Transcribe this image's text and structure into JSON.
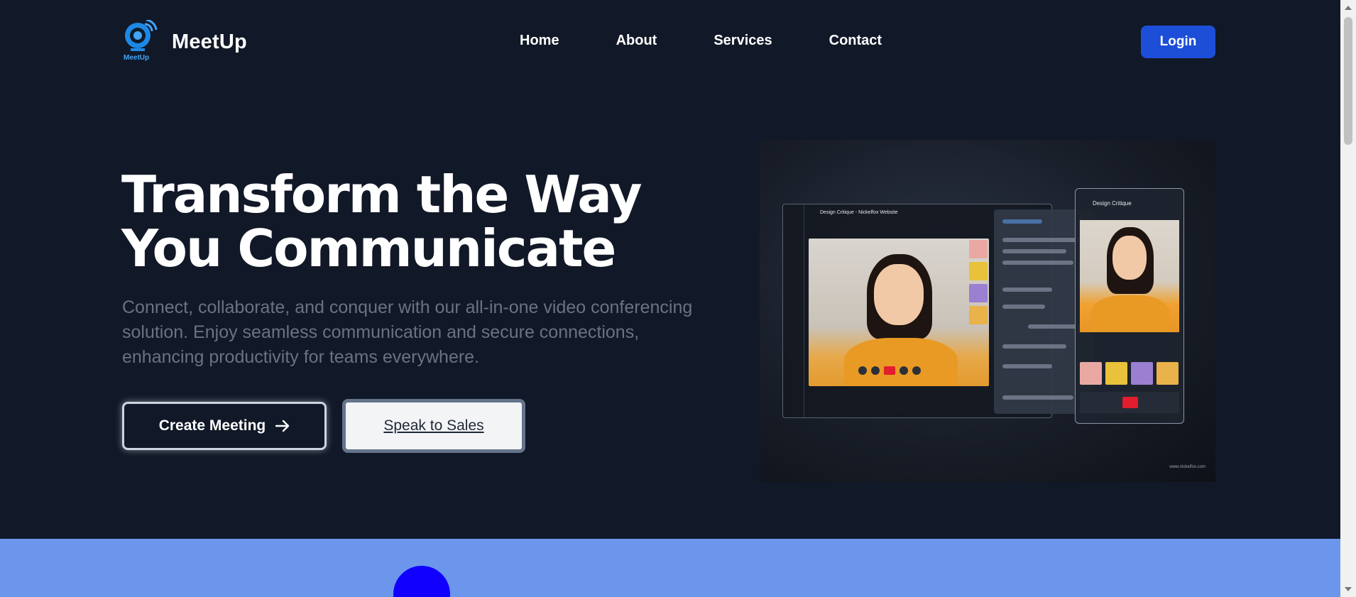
{
  "header": {
    "logo_text": "MeetUp",
    "logo_badge": "MeetUp",
    "nav": [
      "Home",
      "About",
      "Services",
      "Contact"
    ],
    "login_label": "Login"
  },
  "hero": {
    "title": "Transform the Way You Communicate",
    "subtitle": "Connect, collaborate, and conquer with our all-in-one video conferencing solution. Enjoy seamless communication and secure connections, enhancing productivity for teams everywhere.",
    "create_label": "Create Meeting",
    "sales_label": "Speak to Sales"
  },
  "hero_image": {
    "main_title": "Design Critique - Nickelfox Website",
    "phone_title": "Design Critique",
    "watermark": "www.nickelfox.com"
  },
  "colors": {
    "background": "#111827",
    "primary": "#1d4ed8",
    "band": "#6b96ec",
    "blob": "#1200ff"
  }
}
